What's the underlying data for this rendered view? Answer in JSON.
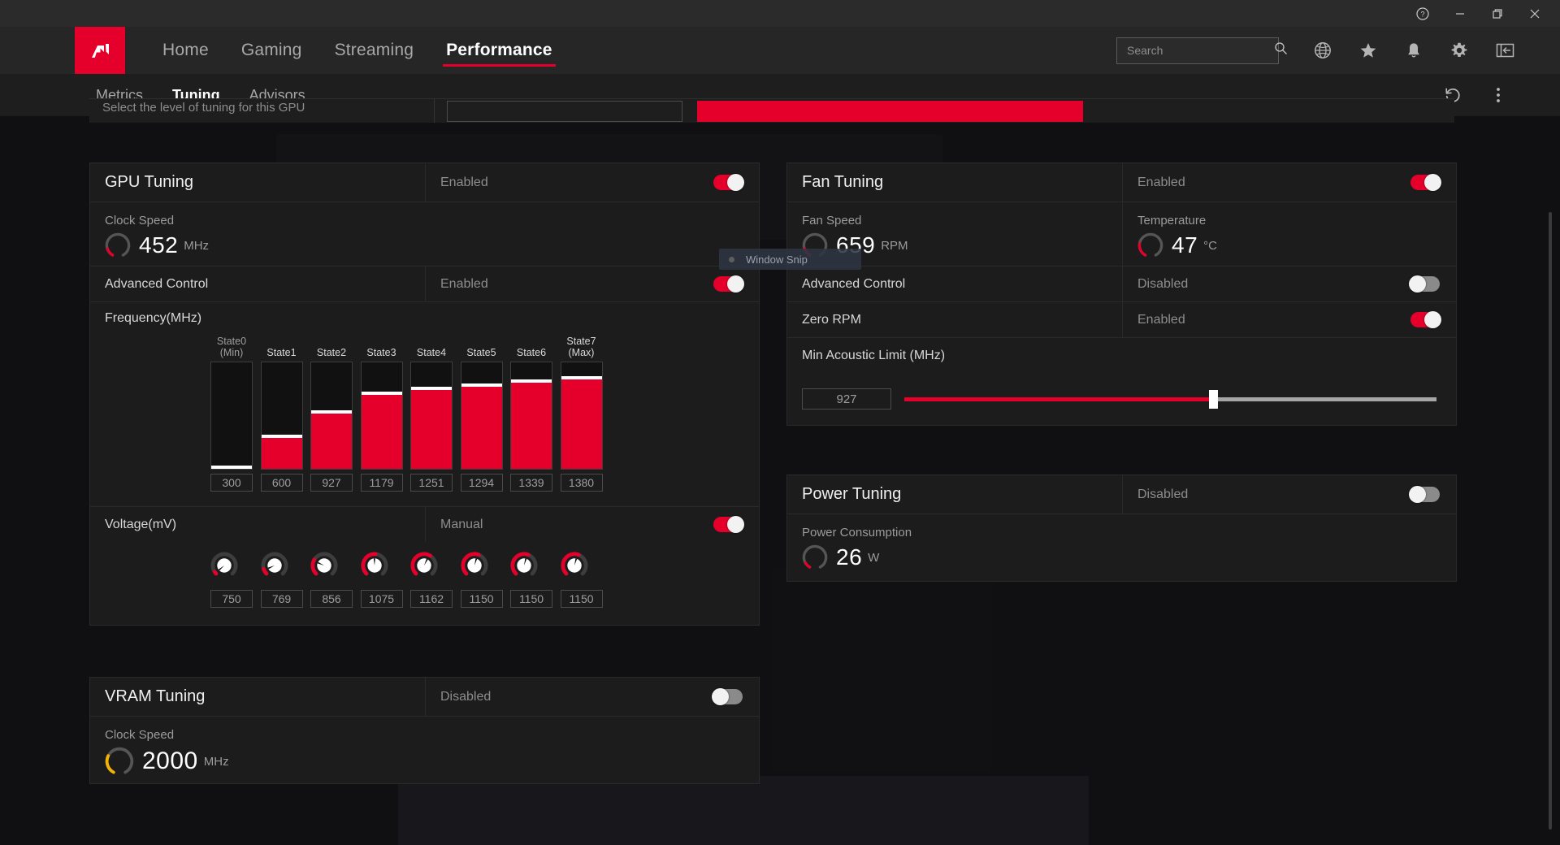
{
  "window": {
    "controls": [
      {
        "name": "help-button",
        "glyph": "?"
      },
      {
        "name": "minimize-button",
        "glyph": "—"
      },
      {
        "name": "restore-button",
        "glyph": "❐"
      },
      {
        "name": "close-button",
        "glyph": "✕"
      }
    ]
  },
  "nav": {
    "brand": "AMD",
    "items": [
      {
        "label": "Home",
        "active": false
      },
      {
        "label": "Gaming",
        "active": false
      },
      {
        "label": "Streaming",
        "active": false
      },
      {
        "label": "Performance",
        "active": true
      }
    ],
    "search": {
      "placeholder": "Search",
      "value": ""
    },
    "icons": [
      "globe-icon",
      "star-icon",
      "bell-icon",
      "gear-icon",
      "panel-collapse-icon"
    ]
  },
  "subnav": {
    "items": [
      {
        "label": "Metrics",
        "active": false
      },
      {
        "label": "Tuning",
        "active": true
      },
      {
        "label": "Advisors",
        "active": false
      }
    ],
    "icons": [
      "reset-icon",
      "more-options-icon"
    ]
  },
  "cut_card": {
    "label": "Select the level of tuning for this GPU"
  },
  "overlay": {
    "snip_label": "Window Snip"
  },
  "gpu_tuning": {
    "title": "GPU Tuning",
    "state": "Enabled",
    "enabled": true,
    "clock_speed": {
      "label": "Clock Speed",
      "value": "452",
      "unit": "MHz",
      "gauge_pct": 12
    },
    "advanced_control": {
      "label": "Advanced Control",
      "state": "Enabled",
      "enabled": true
    },
    "frequency": {
      "label": "Frequency(MHz)"
    },
    "voltage": {
      "label": "Voltage(mV)",
      "state": "Manual",
      "enabled": true
    }
  },
  "vram_tuning": {
    "title": "VRAM Tuning",
    "state": "Disabled",
    "enabled": false,
    "clock_speed": {
      "label": "Clock Speed",
      "value": "2000",
      "unit": "MHz",
      "gauge_pct": 40,
      "gauge_color": "#f5b301"
    }
  },
  "fan_tuning": {
    "title": "Fan Tuning",
    "state": "Enabled",
    "enabled": true,
    "fan_speed": {
      "label": "Fan Speed",
      "value": "659",
      "unit": "RPM",
      "gauge_pct": 12
    },
    "temperature": {
      "label": "Temperature",
      "value": "47",
      "unit": "°C",
      "gauge_pct": 28
    },
    "advanced_control": {
      "label": "Advanced Control",
      "state": "Disabled",
      "enabled": false
    },
    "zero_rpm": {
      "label": "Zero RPM",
      "state": "Enabled",
      "enabled": true
    },
    "min_acoustic_limit": {
      "label": "Min Acoustic Limit (MHz)",
      "value": "927",
      "slider_pct": 58
    }
  },
  "power_tuning": {
    "title": "Power Tuning",
    "state": "Disabled",
    "enabled": false,
    "power_consumption": {
      "label": "Power Consumption",
      "value": "26",
      "unit": "W",
      "gauge_pct": 8
    }
  },
  "colors": {
    "accent": "#e4002b",
    "vram_accent": "#f5b301",
    "card_bg": "#1c1c1c",
    "panel_bg": "#131313"
  },
  "chart_data": {
    "type": "bar",
    "title": "Frequency(MHz)",
    "xlabel": "",
    "ylabel": "Frequency (MHz)",
    "ylim": [
      0,
      1500
    ],
    "grid": false,
    "legend": "none",
    "categories": [
      "State0\n(Min)",
      "State1",
      "State2",
      "State3",
      "State4",
      "State5",
      "State6",
      "State7\n(Max)"
    ],
    "values": [
      300,
      600,
      927,
      1179,
      1251,
      1294,
      1339,
      1380
    ],
    "bar_fill_pct": [
      0,
      30,
      53,
      70,
      75,
      78,
      82,
      85
    ],
    "voltage_labels": [
      "750",
      "769",
      "856",
      "1075",
      "1162",
      "1150",
      "1150",
      "1150"
    ],
    "voltage_values": [
      750,
      769,
      856,
      1075,
      1162,
      1150,
      1150,
      1150
    ],
    "voltage_arc_pct": [
      4,
      10,
      28,
      52,
      62,
      58,
      58,
      58
    ]
  }
}
